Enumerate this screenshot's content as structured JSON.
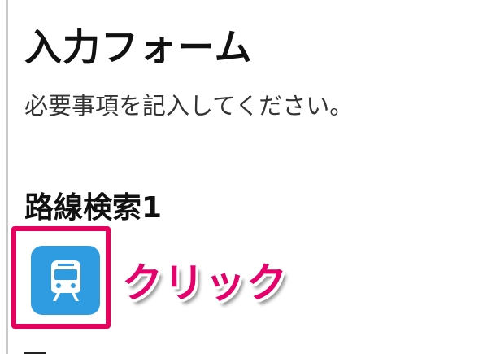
{
  "form": {
    "title": "入力フォーム",
    "description": "必要事項を記入してください。"
  },
  "route_search": {
    "heading": "路線検索1",
    "button_icon": "train-icon"
  },
  "annotation": {
    "callout_text": "クリック",
    "highlight_color": "#e8005e",
    "callout_color": "#e5006b"
  },
  "colors": {
    "train_button_bg": "#2f9be0",
    "border_line": "#c9c9c9"
  }
}
